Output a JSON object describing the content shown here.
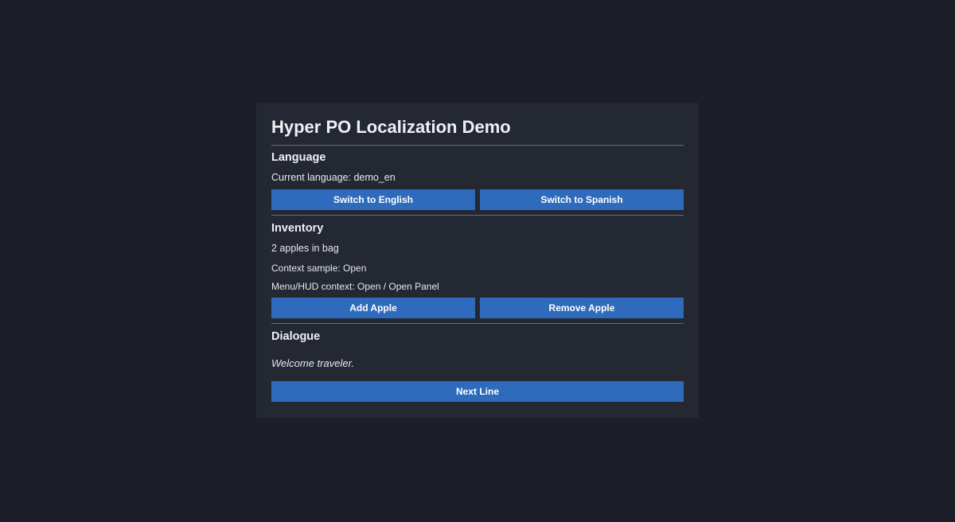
{
  "title": "Hyper PO Localization Demo",
  "language": {
    "heading": "Language",
    "current": "Current language: demo_en",
    "switch_english": "Switch to English",
    "switch_spanish": "Switch to Spanish"
  },
  "inventory": {
    "heading": "Inventory",
    "count_text": "2 apples in bag",
    "context_sample": "Context sample: Open",
    "menu_hud_context": "Menu/HUD context: Open / Open Panel",
    "add_apple": "Add Apple",
    "remove_apple": "Remove Apple"
  },
  "dialogue": {
    "heading": "Dialogue",
    "line": "Welcome traveler.",
    "next_line": "Next Line"
  },
  "colors": {
    "background": "#1c1f28",
    "panel": "#242833",
    "button": "#2f6bbd",
    "divider": "#6a6e77"
  }
}
